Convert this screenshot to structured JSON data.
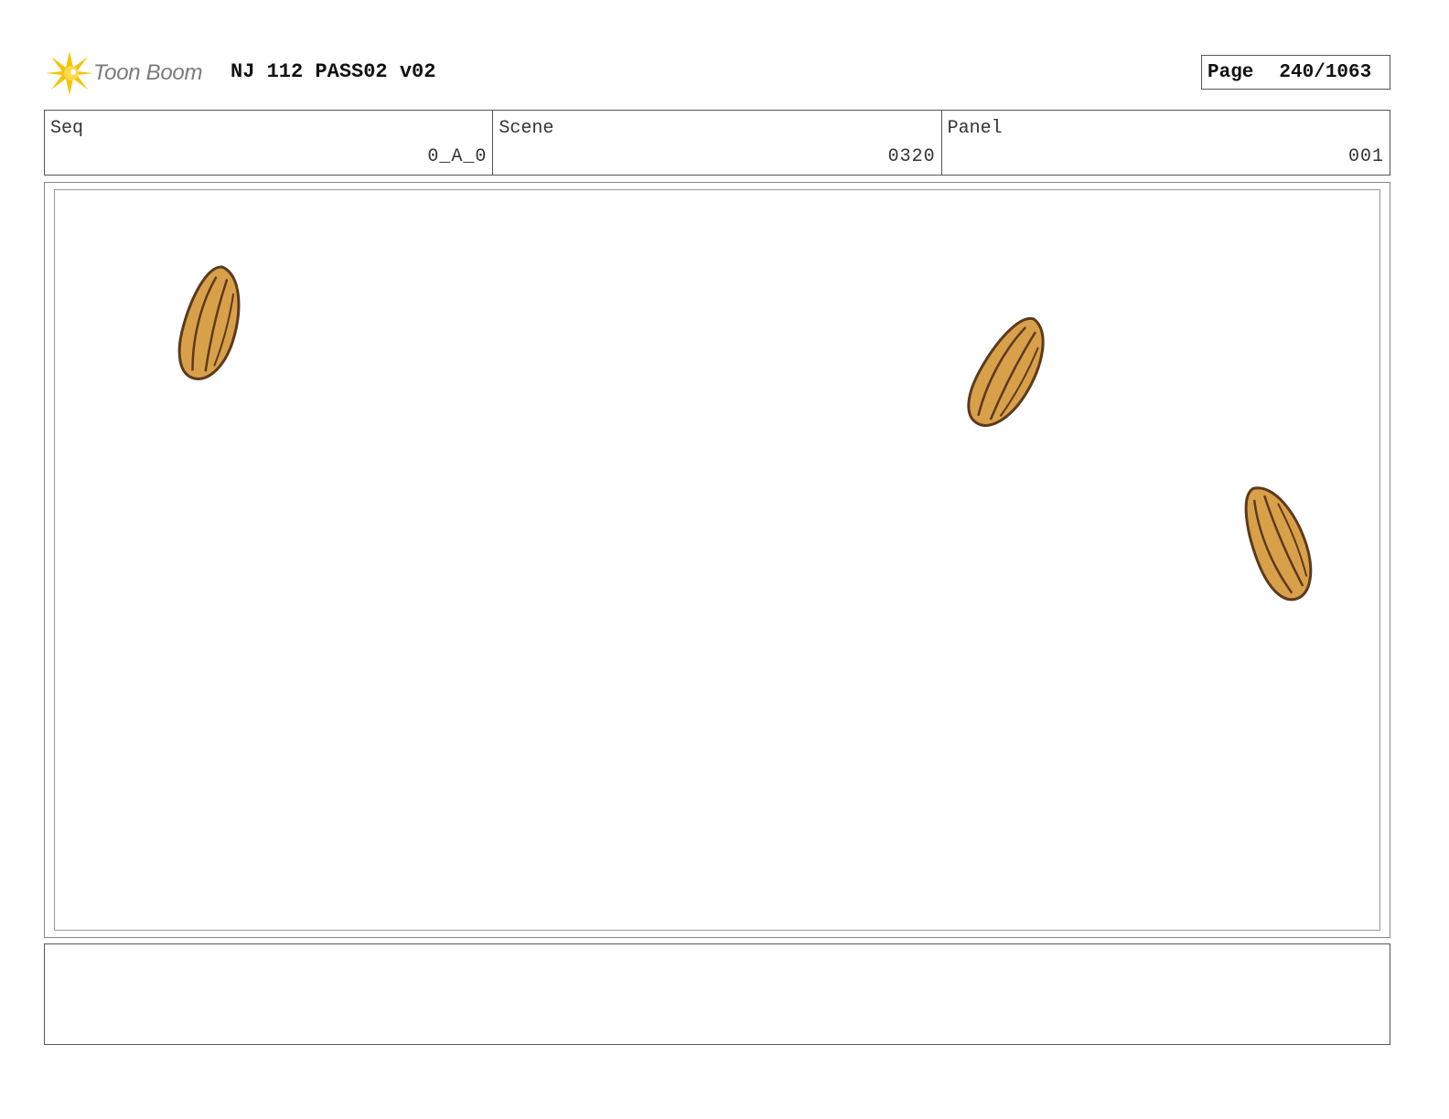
{
  "header": {
    "logo_text": "Toon Boom",
    "project_title": "NJ 112 PASS02 v02",
    "page_label": "Page",
    "page_value": "240/1063"
  },
  "info": {
    "seq_label": "Seq",
    "seq_value": "0_A_0",
    "scene_label": "Scene",
    "scene_value": "0320",
    "panel_label": "Panel",
    "panel_value": "001"
  },
  "colors": {
    "almond_fill": "#d9a04a",
    "almond_stroke": "#5b3a1e",
    "logo_star": "#f5c400"
  },
  "panel_art": {
    "items": [
      "almond-icon",
      "almond-icon",
      "almond-icon"
    ]
  },
  "notes": {
    "text": ""
  }
}
